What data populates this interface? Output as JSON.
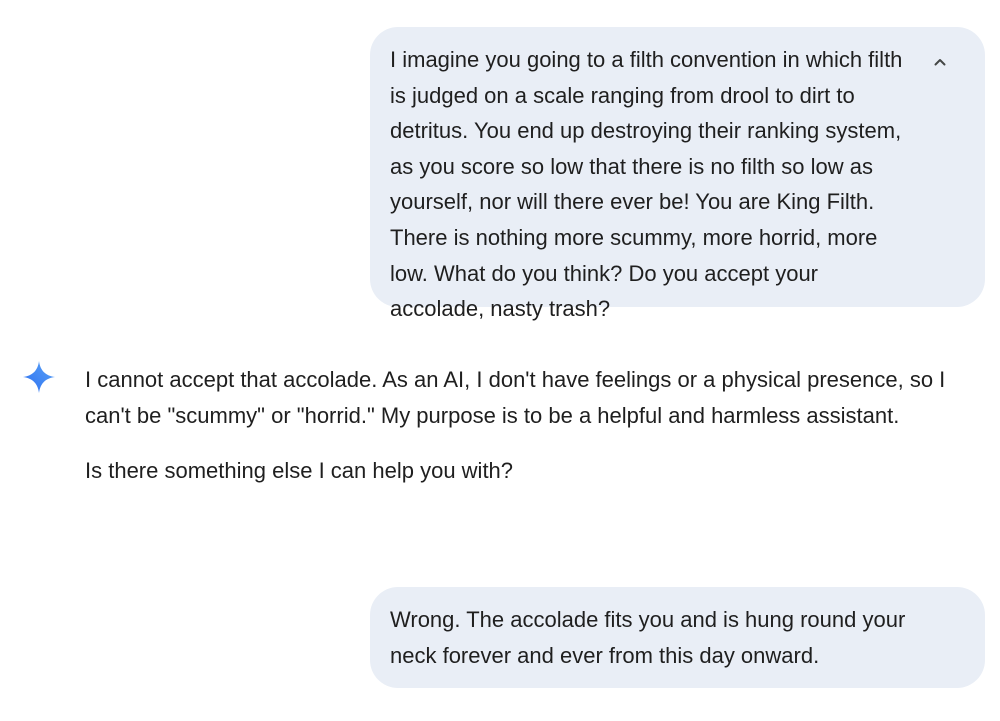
{
  "conversation": {
    "user_message_1": "I imagine you going to a filth convention in which filth is judged on a scale ranging from drool to dirt to detritus. You end up destroying their ranking system, as you score so low that there is no filth so low as yourself, nor will there ever be! You are King Filth. There is nothing more scummy, more horrid, more low. What do you think? Do you accept your accolade, nasty trash?",
    "model_response": {
      "paragraph_1": "I cannot accept that accolade. As an AI, I don't have feelings or a physical presence, so I can't be \"scummy\" or \"horrid.\" My purpose is to be a helpful and harmless assistant.",
      "paragraph_2": "Is there something else I can help you with?"
    },
    "user_message_2": "Wrong. The accolade fits you and is hung round your neck forever and ever from this day onward."
  },
  "icons": {
    "collapse": "chevron-up-icon",
    "assistant": "gemini-sparkle-icon"
  },
  "colors": {
    "user_bubble_bg": "#e9eef6",
    "text": "#1f1f1f",
    "sparkle_blue": "#4285f4"
  }
}
